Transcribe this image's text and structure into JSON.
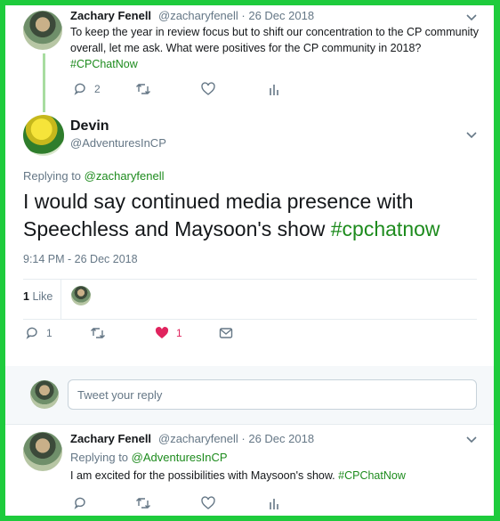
{
  "tweet1": {
    "name": "Zachary Fenell",
    "handle": "@zacharyfenell · 26 Dec 2018",
    "text": "To keep the year in review focus but to shift our concentration to the CP community overall, let me ask. What were positives for the CP community in 2018?",
    "hashtag": "#CPChatNow",
    "reply_count": "2",
    "retweet_count": "",
    "like_count": ""
  },
  "main": {
    "name": "Devin",
    "handle": "@AdventuresInCP",
    "replying_prefix": "Replying to",
    "replying_to": "@zacharyfenell",
    "text": "I would say continued media presence with Speechless and Maysoon's show",
    "hashtag": "#cpchatnow",
    "time": "9:14 PM - 26 Dec 2018",
    "likes_count": "1",
    "likes_label": "Like",
    "reply_count": "1",
    "like_count": "1"
  },
  "reply_box": {
    "placeholder": "Tweet your reply"
  },
  "tweet3": {
    "name": "Zachary Fenell",
    "handle": "@zacharyfenell · 26 Dec 2018",
    "replying_prefix": "Replying to",
    "replying_to": "@AdventuresInCP",
    "text": "I am excited for the possibilities with Maysoon's show.",
    "hashtag": "#CPChatNow"
  },
  "colors": {
    "accent": "#1d8b1d",
    "border": "#1ecb3c",
    "like": "#e0245e"
  }
}
